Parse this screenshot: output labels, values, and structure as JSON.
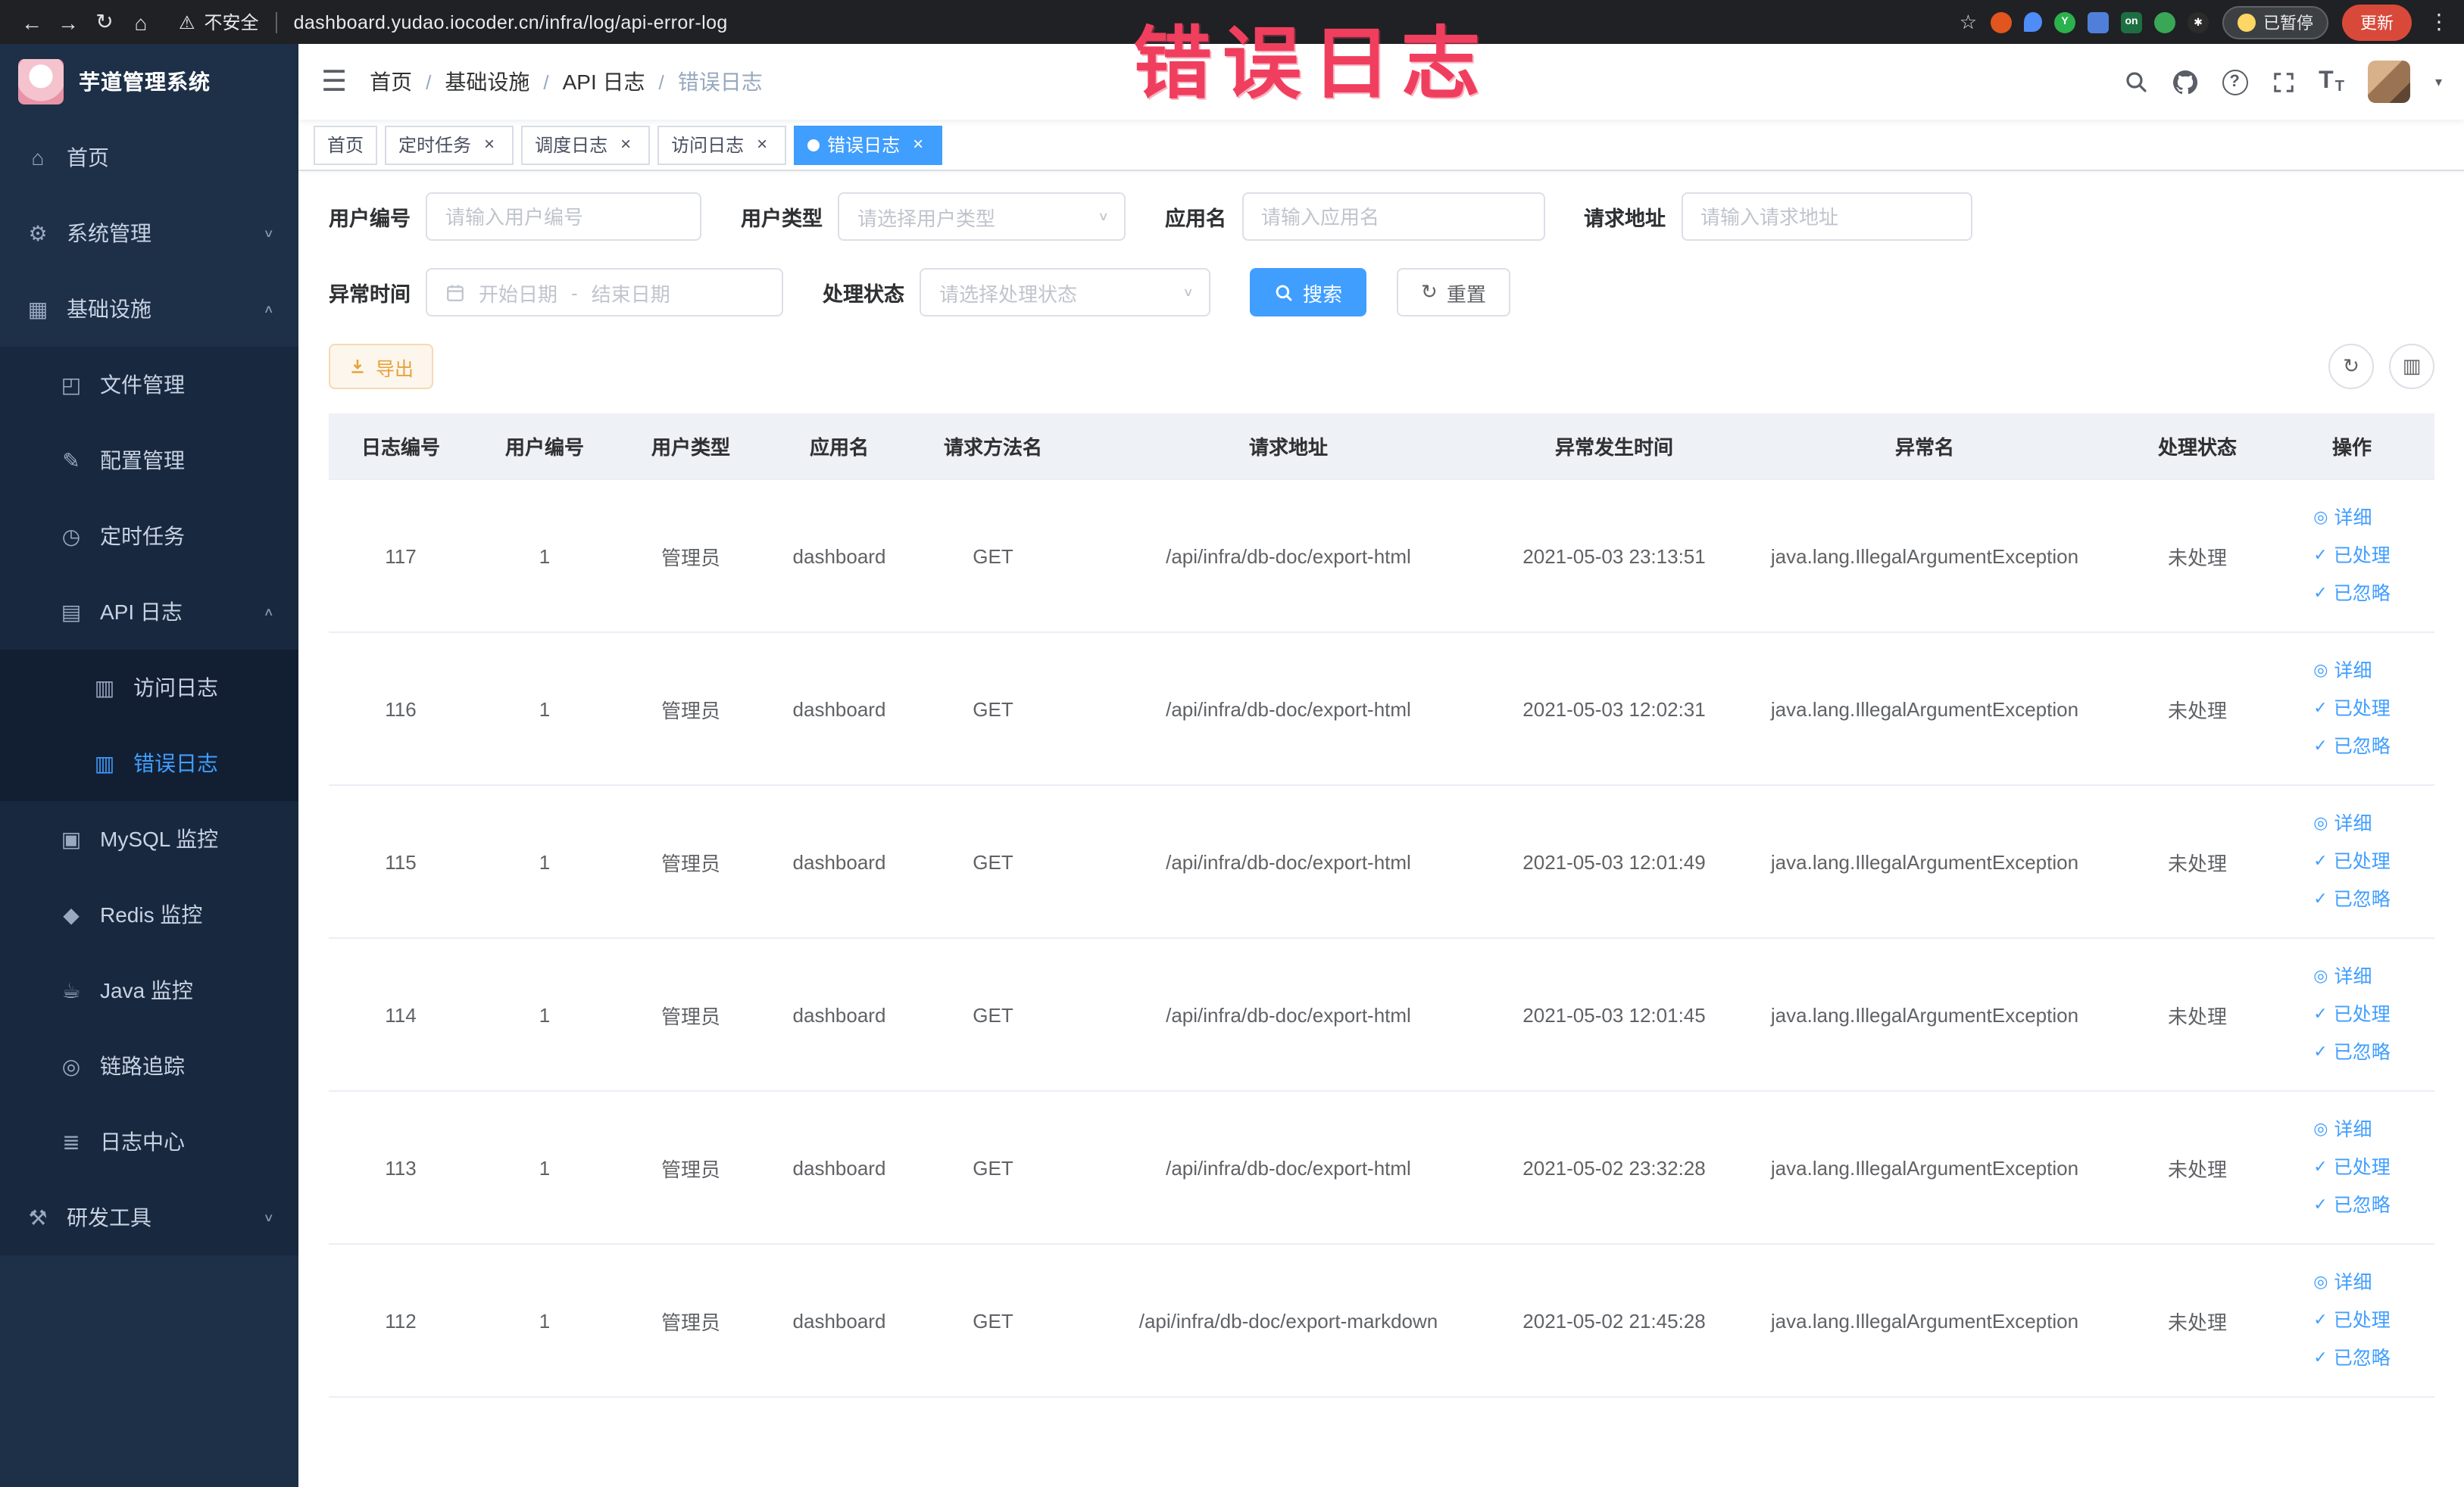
{
  "annotation": {
    "text": "错误日志"
  },
  "browser": {
    "security_label": "不安全",
    "url": "dashboard.yudao.iocoder.cn/infra/log/api-error-log",
    "paused_badge": "已暂停",
    "update_button": "更新",
    "extensions": [
      {
        "id": "ext-orange",
        "color": "#e1551e",
        "shape": "circle",
        "glyph": ""
      },
      {
        "id": "ext-blue-drop",
        "color": "#4e8cf7",
        "shape": "drop",
        "glyph": ""
      },
      {
        "id": "ext-green",
        "color": "#2bb24c",
        "shape": "circle",
        "glyph": "Y"
      },
      {
        "id": "ext-grid",
        "color": "#4f7fd9",
        "shape": "square",
        "glyph": ""
      },
      {
        "id": "ext-on",
        "color": "#1d6f42",
        "shape": "square",
        "glyph": "on"
      },
      {
        "id": "ext-leaf",
        "color": "#3aa757",
        "shape": "circle",
        "glyph": ""
      },
      {
        "id": "ext-paw",
        "color": "#2b2b2b",
        "shape": "circle",
        "glyph": "✱"
      }
    ]
  },
  "sidebar": {
    "logo_title": "芋道管理系统",
    "items": [
      {
        "id": "home",
        "label": "首页",
        "icon": "home-icon",
        "level": 1
      },
      {
        "id": "system",
        "label": "系统管理",
        "icon": "system-gear-icon",
        "level": 1,
        "arrow": "down"
      },
      {
        "id": "infra",
        "label": "基础设施",
        "icon": "infra-icon",
        "level": 1,
        "arrow": "up"
      },
      {
        "id": "file",
        "label": "文件管理",
        "icon": "file-icon",
        "level": 2
      },
      {
        "id": "config",
        "label": "配置管理",
        "icon": "config-icon",
        "level": 2
      },
      {
        "id": "job",
        "label": "定时任务",
        "icon": "task-icon",
        "level": 2
      },
      {
        "id": "api-log",
        "label": "API 日志",
        "icon": "api-log-icon",
        "level": 2,
        "arrow": "up"
      },
      {
        "id": "access-log",
        "label": "访问日志",
        "icon": "access-log-icon",
        "level": 3
      },
      {
        "id": "error-log",
        "label": "错误日志",
        "icon": "error-log-icon",
        "level": 3,
        "active": true
      },
      {
        "id": "mysql",
        "label": "MySQL 监控",
        "icon": "mysql-icon",
        "level": 2
      },
      {
        "id": "redis",
        "label": "Redis 监控",
        "icon": "redis-icon",
        "level": 2
      },
      {
        "id": "java",
        "label": "Java 监控",
        "icon": "java-icon",
        "level": 2
      },
      {
        "id": "trace",
        "label": "链路追踪",
        "icon": "trace-icon",
        "level": 2
      },
      {
        "id": "log-center",
        "label": "日志中心",
        "icon": "log-center-icon",
        "level": 2
      },
      {
        "id": "dev-tools",
        "label": "研发工具",
        "icon": "tools-icon",
        "level": 1,
        "arrow": "down",
        "shade": true
      }
    ]
  },
  "header": {
    "breadcrumb": [
      "首页",
      "基础设施",
      "API 日志",
      "错误日志"
    ],
    "separator": "/"
  },
  "tabs": [
    {
      "id": "home",
      "label": "首页",
      "closable": false,
      "active": false
    },
    {
      "id": "job",
      "label": "定时任务",
      "closable": true,
      "active": false
    },
    {
      "id": "job-log",
      "label": "调度日志",
      "closable": true,
      "active": false
    },
    {
      "id": "access-log",
      "label": "访问日志",
      "closable": true,
      "active": false
    },
    {
      "id": "error-log",
      "label": "错误日志",
      "closable": true,
      "active": true
    }
  ],
  "filters": {
    "user_id": {
      "label": "用户编号",
      "placeholder": "请输入用户编号"
    },
    "user_type": {
      "label": "用户类型",
      "placeholder": "请选择用户类型"
    },
    "app_name": {
      "label": "应用名",
      "placeholder": "请输入应用名"
    },
    "request_url": {
      "label": "请求地址",
      "placeholder": "请输入请求地址"
    },
    "exception_time": {
      "label": "异常时间",
      "start_placeholder": "开始日期",
      "separator": "-",
      "end_placeholder": "结束日期"
    },
    "process_status": {
      "label": "处理状态",
      "placeholder": "请选择处理状态"
    },
    "search_button": "搜索",
    "reset_button": "重置"
  },
  "toolbar": {
    "export_button": "导出"
  },
  "table": {
    "headers": [
      "日志编号",
      "用户编号",
      "用户类型",
      "应用名",
      "请求方法名",
      "请求地址",
      "异常发生时间",
      "异常名",
      "处理状态",
      "操作"
    ],
    "rows": [
      {
        "id": "117",
        "user_id": "1",
        "user_type": "管理员",
        "app": "dashboard",
        "method": "GET",
        "url": "/api/infra/db-doc/export-html",
        "time": "2021-05-03 23:13:51",
        "exception": "java.lang.IllegalArgumentException",
        "status": "未处理"
      },
      {
        "id": "116",
        "user_id": "1",
        "user_type": "管理员",
        "app": "dashboard",
        "method": "GET",
        "url": "/api/infra/db-doc/export-html",
        "time": "2021-05-03 12:02:31",
        "exception": "java.lang.IllegalArgumentException",
        "status": "未处理"
      },
      {
        "id": "115",
        "user_id": "1",
        "user_type": "管理员",
        "app": "dashboard",
        "method": "GET",
        "url": "/api/infra/db-doc/export-html",
        "time": "2021-05-03 12:01:49",
        "exception": "java.lang.IllegalArgumentException",
        "status": "未处理"
      },
      {
        "id": "114",
        "user_id": "1",
        "user_type": "管理员",
        "app": "dashboard",
        "method": "GET",
        "url": "/api/infra/db-doc/export-html",
        "time": "2021-05-03 12:01:45",
        "exception": "java.lang.IllegalArgumentException",
        "status": "未处理"
      },
      {
        "id": "113",
        "user_id": "1",
        "user_type": "管理员",
        "app": "dashboard",
        "method": "GET",
        "url": "/api/infra/db-doc/export-html",
        "time": "2021-05-02 23:32:28",
        "exception": "java.lang.IllegalArgumentException",
        "status": "未处理"
      },
      {
        "id": "112",
        "user_id": "1",
        "user_type": "管理员",
        "app": "dashboard",
        "method": "GET",
        "url": "/api/infra/db-doc/export-markdown",
        "time": "2021-05-02 21:45:28",
        "exception": "java.lang.IllegalArgumentException",
        "status": "未处理"
      }
    ],
    "actions": {
      "detail": "详细",
      "processed": "已处理",
      "ignored": "已忽略"
    }
  }
}
